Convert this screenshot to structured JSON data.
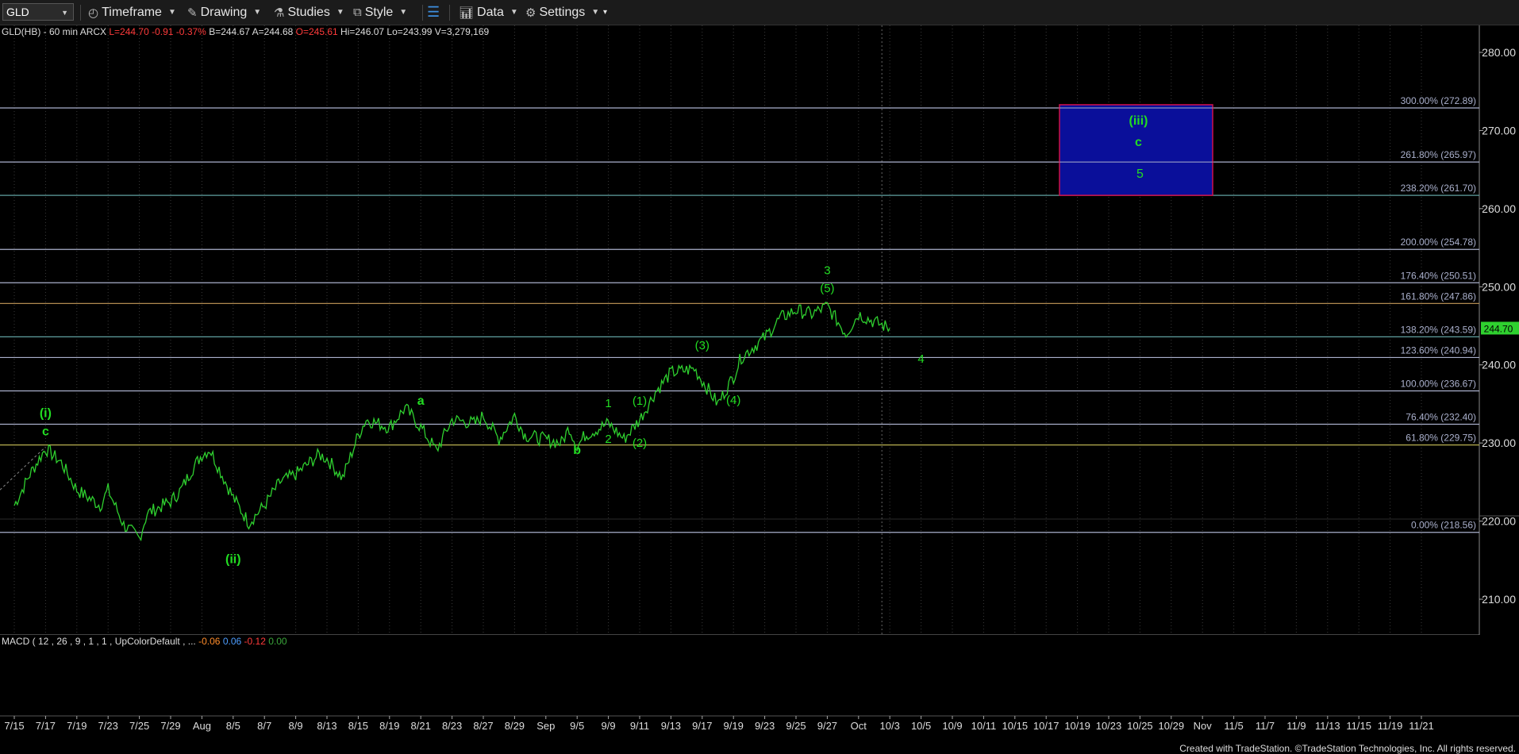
{
  "toolbar": {
    "symbol": "GLD",
    "timeframe": "Timeframe",
    "drawing": "Drawing",
    "studies": "Studies",
    "style": "Style",
    "data": "Data",
    "settings": "Settings"
  },
  "info": {
    "symbol_desc": "GLD(HB) - 60 min  ARCX",
    "last": "L=244.70",
    "change": "-0.91",
    "change_pct": "-0.37%",
    "quote": "B=244.67  A=244.68",
    "open": "O=245.61",
    "hilo": "Hi=246.07  Lo=243.99  V=3,279,169"
  },
  "macd": {
    "label": "MACD ( 12 , 26 , 9 , 1 , 1 , UpColorDefault , ...",
    "v1": "-0.06",
    "v2": "0.06",
    "v3": "-0.12",
    "v4": "0.00"
  },
  "footer": "Created with TradeStation. ©TradeStation Technologies, Inc. All rights reserved.",
  "chart_data": {
    "type": "line",
    "ylim": [
      203,
      283
    ],
    "price_ticks": [
      "280.00",
      "270.00",
      "260.00",
      "250.00",
      "240.00",
      "230.00",
      "220.00",
      "210.00"
    ],
    "current_price": "244.70",
    "date_ticks": [
      "7/15",
      "7/17",
      "7/19",
      "7/23",
      "7/25",
      "7/29",
      "Aug",
      "8/5",
      "8/7",
      "8/9",
      "8/13",
      "8/15",
      "8/19",
      "8/21",
      "8/23",
      "8/27",
      "8/29",
      "Sep",
      "9/5",
      "9/9",
      "9/11",
      "9/13",
      "9/17",
      "9/19",
      "9/23",
      "9/25",
      "9/27",
      "Oct",
      "10/3",
      "10/5",
      "10/9",
      "10/11",
      "10/15",
      "10/17",
      "10/19",
      "10/23",
      "10/25",
      "10/29",
      "Nov",
      "11/5",
      "11/7",
      "11/9",
      "11/13",
      "11/15",
      "11/19",
      "11/21"
    ],
    "fib_levels": [
      {
        "label": "300.00% (272.89)",
        "price": 272.89,
        "color": "#aab0cc"
      },
      {
        "label": "261.80% (265.97)",
        "price": 265.97,
        "color": "#aab0cc"
      },
      {
        "label": "238.20% (261.70)",
        "price": 261.7,
        "color": "#5fa0a0"
      },
      {
        "label": "200.00% (254.78)",
        "price": 254.78,
        "color": "#aab0cc"
      },
      {
        "label": "176.40% (250.51)",
        "price": 250.51,
        "color": "#aab0cc"
      },
      {
        "label": "161.80% (247.86)",
        "price": 247.86,
        "color": "#b08a50"
      },
      {
        "label": "138.20% (243.59)",
        "price": 243.59,
        "color": "#5fa0a0"
      },
      {
        "label": "123.60% (240.94)",
        "price": 240.94,
        "color": "#aab0cc"
      },
      {
        "label": "100.00% (236.67)",
        "price": 236.67,
        "color": "#aab0cc"
      },
      {
        "label": "76.40% (232.40)",
        "price": 232.4,
        "color": "#aab0cc"
      },
      {
        "label": "61.80% (229.75)",
        "price": 229.75,
        "color": "#b8b050"
      },
      {
        "label": "0.00% (218.56)",
        "price": 218.56,
        "color": "#aab0cc"
      }
    ],
    "target_box": {
      "top": 273.3,
      "bottom": 261.7,
      "start": "10/25",
      "end": "11/5",
      "labels": [
        "(iii)",
        "c",
        "5"
      ]
    },
    "wave_labels": [
      {
        "t": "(i)",
        "x": "7/17",
        "y": 233.3,
        "bold": true
      },
      {
        "t": "c",
        "x": "7/17",
        "y": 231.0,
        "bold": true
      },
      {
        "t": "(ii)",
        "x": "8/5",
        "y": 214.6,
        "bold": true
      },
      {
        "t": "a",
        "x": "8/21",
        "y": 234.9,
        "bold": true
      },
      {
        "t": "b",
        "x": "9/5",
        "y": 228.6,
        "bold": true
      },
      {
        "t": "1",
        "x": "9/9",
        "y": 234.6,
        "bold": false
      },
      {
        "t": "2",
        "x": "9/9",
        "y": 230.0,
        "bold": false
      },
      {
        "t": "(1)",
        "x": "9/11",
        "y": 234.9,
        "bold": false
      },
      {
        "t": "(2)",
        "x": "9/11",
        "y": 229.5,
        "bold": false
      },
      {
        "t": "(3)",
        "x": "9/17",
        "y": 242.0,
        "bold": false
      },
      {
        "t": "(4)",
        "x": "9/19",
        "y": 235.0,
        "bold": false
      },
      {
        "t": "(5)",
        "x": "9/27",
        "y": 249.3,
        "bold": false
      },
      {
        "t": "3",
        "x": "9/27",
        "y": 251.6,
        "bold": false
      },
      {
        "t": "4",
        "x": "10/5",
        "y": 240.3,
        "bold": false
      }
    ],
    "price_path": [
      [
        "7/15",
        222.0
      ],
      [
        "7/16",
        226.0
      ],
      [
        "7/17",
        229.3
      ],
      [
        "7/18",
        227.5
      ],
      [
        "7/19",
        224.0
      ],
      [
        "7/22",
        222.0
      ],
      [
        "7/23",
        224.0
      ],
      [
        "7/24",
        219.5
      ],
      [
        "7/25",
        217.8
      ],
      [
        "7/26",
        221.0
      ],
      [
        "7/29",
        222.5
      ],
      [
        "7/30",
        224.0
      ],
      [
        "7/31",
        226.5
      ],
      [
        "8/1",
        228.5
      ],
      [
        "8/2",
        229.2
      ],
      [
        "8/5",
        223.0
      ],
      [
        "8/6",
        219.8
      ],
      [
        "8/7",
        222.0
      ],
      [
        "8/8",
        225.0
      ],
      [
        "8/9",
        226.0
      ],
      [
        "8/12",
        228.5
      ],
      [
        "8/13",
        228.0
      ],
      [
        "8/14",
        225.5
      ],
      [
        "8/15",
        231.0
      ],
      [
        "8/16",
        233.0
      ],
      [
        "8/19",
        232.0
      ],
      [
        "8/20",
        234.5
      ],
      [
        "8/21",
        232.0
      ],
      [
        "8/22",
        229.0
      ],
      [
        "8/23",
        233.0
      ],
      [
        "8/26",
        232.5
      ],
      [
        "8/27",
        233.5
      ],
      [
        "8/28",
        230.5
      ],
      [
        "8/29",
        233.5
      ],
      [
        "8/30",
        231.0
      ],
      [
        "9/3",
        230.0
      ],
      [
        "9/4",
        232.0
      ],
      [
        "9/5",
        229.5
      ],
      [
        "9/6",
        231.0
      ],
      [
        "9/9",
        232.5
      ],
      [
        "9/10",
        230.5
      ],
      [
        "9/11",
        233.0
      ],
      [
        "9/12",
        236.5
      ],
      [
        "9/13",
        239.0
      ],
      [
        "9/16",
        239.5
      ],
      [
        "9/17",
        238.0
      ],
      [
        "9/18",
        235.0
      ],
      [
        "9/19",
        238.5
      ],
      [
        "9/20",
        241.0
      ],
      [
        "9/23",
        243.5
      ],
      [
        "9/24",
        246.0
      ],
      [
        "9/25",
        247.0
      ],
      [
        "9/26",
        246.5
      ],
      [
        "9/27",
        247.5
      ],
      [
        "9/30",
        244.0
      ],
      [
        "10/1",
        246.5
      ],
      [
        "10/2",
        245.5
      ],
      [
        "10/3",
        244.7
      ]
    ]
  }
}
